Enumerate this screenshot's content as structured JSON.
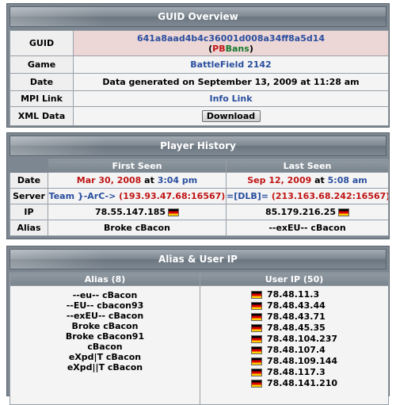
{
  "guid_overview": {
    "title": "GUID Overview",
    "rows": {
      "guid_label": "GUID",
      "guid_value": "641a8aad4b4c36001d008a34ff8a5d14",
      "guid_open": "(",
      "guid_pb": "PBBans",
      "guid_close": ")",
      "game_label": "Game",
      "game_value": "BattleField 2142",
      "date_label": "Date",
      "date_value": "Data generated on September 13, 2009 at 11:28 am",
      "mpi_label": "MPI Link",
      "mpi_value": "Info Link",
      "xml_label": "XML Data",
      "xml_button": "Download"
    }
  },
  "player_history": {
    "title": "Player History",
    "first_seen": "First Seen",
    "last_seen": "Last Seen",
    "date_label": "Date",
    "first_date": "Mar 30, 2008",
    "first_at": "at",
    "first_time": "3:04 pm",
    "last_date": "Sep 12, 2009",
    "last_at": "at",
    "last_time": "5:08 am",
    "server_label": "Server",
    "first_server_name": "Team }-ArC->",
    "first_server_addr": "(193.93.47.68:16567)",
    "last_server_name": "=[DLB]=",
    "last_server_addr": "(213.163.68.242:16567)",
    "ip_label": "IP",
    "first_ip": "78.55.147.185",
    "last_ip": "85.179.216.25",
    "alias_label": "Alias",
    "first_alias": "Broke cBacon",
    "last_alias": "--exEU-- cBacon"
  },
  "alias_ip": {
    "title": "Alias & User IP",
    "alias_header": "Alias (8)",
    "ip_header": "User IP (50)",
    "aliases": [
      "--eu-- cBacon",
      "--EU-- cbacon93",
      "--exEU-- cBacon",
      "Broke cBacon",
      "Broke cBacon91",
      "cBacon",
      "eXpd|T cBacon",
      "eXpd||T cBacon"
    ],
    "ips": [
      "78.48.11.3",
      "78.48.43.44",
      "78.48.43.71",
      "78.48.45.35",
      "78.48.104.237",
      "78.48.107.4",
      "78.48.109.144",
      "78.48.117.3",
      "78.48.141.210"
    ]
  },
  "colors": {
    "panel": "#7d8791",
    "link_blue": "#2a4f9e",
    "date_red": "#c01515",
    "pbbans_green": "#157a2e"
  }
}
